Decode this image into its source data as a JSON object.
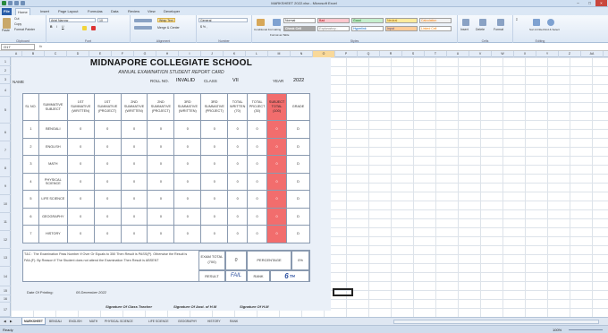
{
  "window": {
    "title": "MARKSHEET 2022.xlsx - Microsoft Excel"
  },
  "ribbon": {
    "tabs": [
      "File",
      "Home",
      "Insert",
      "Page Layout",
      "Formulas",
      "Data",
      "Review",
      "View",
      "Developer"
    ],
    "clipboard": {
      "paste": "Paste",
      "cut": "Cut",
      "copy": "Copy",
      "format_painter": "Format Painter",
      "label": "Clipboard"
    },
    "font": {
      "name": "Arial Narrow",
      "size": "10",
      "label": "Font"
    },
    "alignment": {
      "wrap": "Wrap Text",
      "merge": "Merge & Center",
      "label": "Alignment"
    },
    "number": {
      "format": "General",
      "label": "Number"
    },
    "styles": {
      "cond": "Conditional Formatting",
      "format_table": "Format as Table",
      "cells": [
        "Normal",
        "Bad",
        "Good",
        "Neutral",
        "Calculation",
        "Check Cell",
        "Explanatory...",
        "Hyperlink",
        "Input",
        "Linked Cell"
      ],
      "label": "Styles"
    },
    "cells": {
      "insert": "Insert",
      "delete": "Delete",
      "format": "Format",
      "label": "Cells"
    },
    "editing": {
      "sort": "Sort & Filter",
      "find": "Find & Select",
      "label": "Editing"
    }
  },
  "formula_bar": {
    "name_box": "O17",
    "fx": "fx"
  },
  "columns": [
    "A",
    "B",
    "C",
    "D",
    "E",
    "F",
    "G",
    "H",
    "I",
    "J",
    "K",
    "L",
    "M",
    "N",
    "O",
    "P",
    "Q",
    "R",
    "S",
    "T",
    "U",
    "V",
    "W",
    "X",
    "Y",
    "Z",
    "AA"
  ],
  "report": {
    "school": "MIDNAPORE COLLEGIATE SCHOOL",
    "subtitle": "ANNUAL EXAMINATION STUDENT REPORT CARD",
    "name_label": "NAME",
    "roll_label": "ROLL NO.",
    "roll_value": "INVALID",
    "class_label": "CLASS",
    "class_value": "VII",
    "year_label": "YEAR",
    "year_value": "2022",
    "headers": [
      "SL NO.",
      "SUMMATIVE SUBJECT",
      "1ST SUMMATIVE (WRITTEN)",
      "1ST SUMMATIVE (PROJECT)",
      "2ND SUMMATIVE (WRITTEN)",
      "2ND SUMMATIVE (PROJECT)",
      "3RD SUMMATIVE (WRITTEN)",
      "3RD SUMMATIVE (PROJECT)",
      "TOTAL WRITTEN (70)",
      "TOTAL PROJECT (30)",
      "SUBJECT TOTAL (100)",
      "GRADE"
    ],
    "rows": [
      [
        "1",
        "BENGALI",
        "0",
        "0",
        "0",
        "0",
        "0",
        "0",
        "0",
        "0",
        "0",
        "D"
      ],
      [
        "2",
        "ENGLISH",
        "0",
        "0",
        "0",
        "0",
        "0",
        "0",
        "0",
        "0",
        "0",
        "D"
      ],
      [
        "3",
        "MATH",
        "0",
        "0",
        "0",
        "0",
        "0",
        "0",
        "0",
        "0",
        "0",
        "D"
      ],
      [
        "4",
        "PHYSICAL SCIENCE",
        "0",
        "0",
        "0",
        "0",
        "0",
        "0",
        "0",
        "0",
        "0",
        "D"
      ],
      [
        "5",
        "LIFE SCIENCE",
        "0",
        "0",
        "0",
        "0",
        "0",
        "0",
        "0",
        "0",
        "0",
        "D"
      ],
      [
        "6",
        "GEOGRAPHY",
        "0",
        "0",
        "0",
        "0",
        "0",
        "0",
        "0",
        "0",
        "0",
        "D"
      ],
      [
        "7",
        "HISTORY",
        "0",
        "0",
        "0",
        "0",
        "0",
        "0",
        "0",
        "0",
        "0",
        "D"
      ]
    ],
    "tnc": "T&C : The Examination Pass Number If Over Or Equals to 350 Then Result is PASS(P). Otherwise the Result is FAIL(F). By Reason If The Student does not attend the Examination Then Result is ABSENT",
    "exam_total_label": "EXAM TOTAL (700)",
    "exam_total_value": "0",
    "percentage_label": "PERCENTAGE",
    "percentage_value": "0%",
    "result_label": "RESULT",
    "result_value": "FAIL",
    "rank_label": "RANK",
    "rank_value": "6",
    "rank_suffix": "TH",
    "printing_label": "Date Of Printing:",
    "printing_value": "05 December 2022",
    "sign_teacher": "Signature Of Class Teacher",
    "sign_asst_hm": "Signature Of Asst. of H.M",
    "sign_hm": "Signature Of H.M"
  },
  "sheet_tabs": [
    "MARKSHEET",
    "BENGALI",
    "ENGLISH",
    "MATH",
    "PHYSICAL SCIENCE",
    "LIFE SCIENCE",
    "GEOGRAPHY",
    "HISTORY",
    "RANK"
  ],
  "status": {
    "ready": "Ready",
    "zoom": "100%"
  },
  "colors": {
    "accent": "#2a5ea9",
    "red_cell": "#f26d6d",
    "sheet_bg": "#eaf0f8"
  }
}
